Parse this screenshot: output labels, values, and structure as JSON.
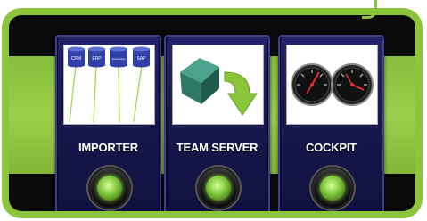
{
  "modules": [
    {
      "label": "IMPORTER",
      "icon": "database-connectors-icon",
      "sources": [
        "CRM",
        "ERP",
        "Accounting",
        "SAP"
      ]
    },
    {
      "label": "TEAM SERVER",
      "icon": "cube-with-arrow-icon"
    },
    {
      "label": "COCKPIT",
      "icon": "gauges-icon"
    }
  ],
  "colors": {
    "frame_green": "#8cc43c",
    "module_blue": "#1a1a55",
    "led_green": "#7ec63b"
  }
}
